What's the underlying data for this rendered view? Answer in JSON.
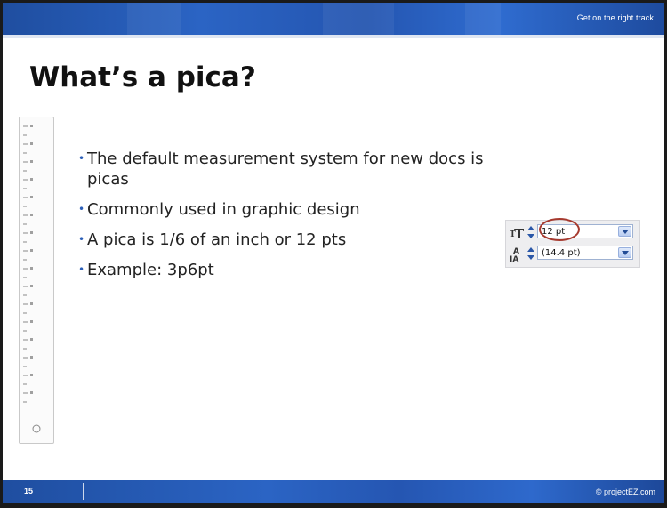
{
  "header": {
    "tagline": "Get on the right track"
  },
  "slide": {
    "title": "What’s a pica?",
    "bullets": [
      "The default measurement system for new docs is picas",
      "Commonly used in graphic design",
      "A pica is 1/6 of an inch or 12 pts",
      "Example: 3p6pt"
    ]
  },
  "font_panel": {
    "font_size_value": "12 pt",
    "leading_value": "(14.4 pt)",
    "font_size_icon": "font-size-icon",
    "leading_icon": "leading-icon",
    "highlight_color": "#a6392e"
  },
  "footer": {
    "slide_number": "15",
    "copyright": "© projectEZ.com"
  },
  "colors": {
    "band": "#2b64c4",
    "bullet": "#2c5fb8"
  }
}
